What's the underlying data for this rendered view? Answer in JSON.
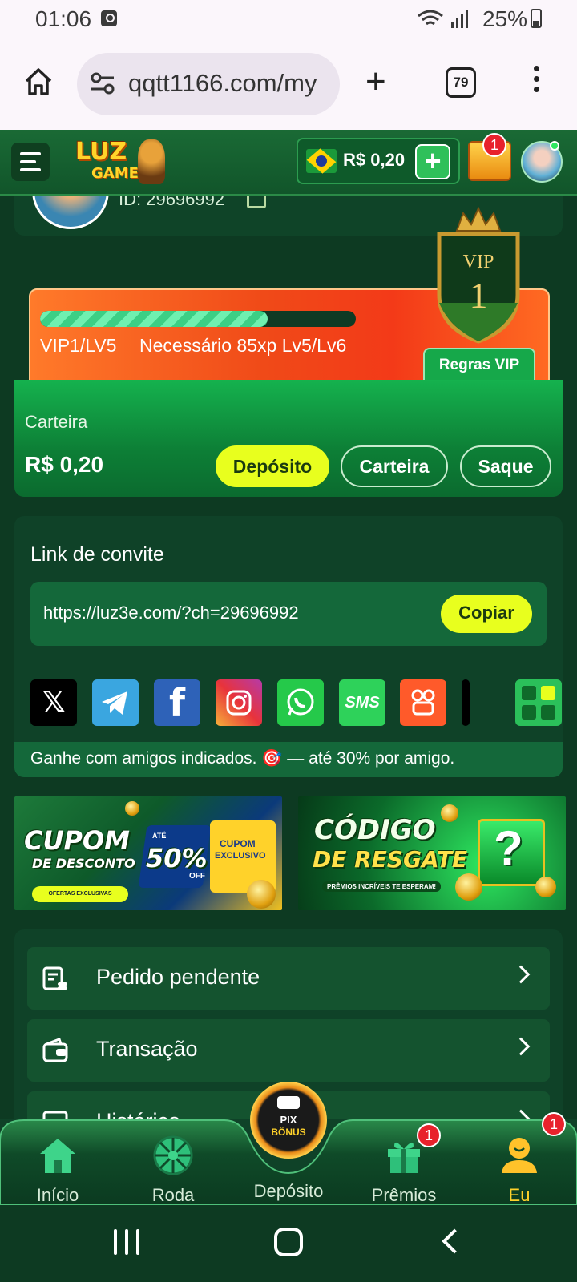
{
  "status_bar": {
    "time": "01:06",
    "battery": "25%"
  },
  "browser": {
    "url": "qqtt1166.com/my",
    "tab_count": "79"
  },
  "header": {
    "logo_line1": "LUZ",
    "logo_line2": "GAMES",
    "balance": "R$ 0,20",
    "gift_badge": "1"
  },
  "profile": {
    "id_text": "ID: 29696992"
  },
  "vip": {
    "shield_label": "VIP",
    "shield_number": "1",
    "level_text": "VIP1/LV5",
    "need_text": "Necessário 85xp Lv5/Lv6",
    "rules_button": "Regras VIP",
    "progress_fraction": 0.72
  },
  "wallet": {
    "title": "Carteira",
    "balance": "R$ 0,20",
    "deposit_button": "Depósito",
    "wallet_button": "Carteira",
    "withdraw_button": "Saque"
  },
  "invite": {
    "title": "Link de convite",
    "link": "https://luz3e.com/?ch=29696992",
    "copy_button": "Copiar",
    "footer": "Ganhe com amigos indicados. 🎯 — até 30% por amigo.",
    "social": [
      "x-icon",
      "telegram-icon",
      "facebook-icon",
      "instagram-icon",
      "whatsapp-icon",
      "sms-icon",
      "kwai-icon",
      "more-icon",
      "apps-icon"
    ],
    "sms_label": "SMS",
    "facebook_glyph": "f",
    "x_glyph": "𝕏"
  },
  "banners": {
    "cupom": {
      "line1": "CUPOM",
      "line2": "DE DESCONTO",
      "percent_prefix": "ATÉ",
      "percent": "50%",
      "off": "OFF",
      "right1": "CUPOM",
      "right2": "EXCLUSIVO",
      "sub": "OFERTAS EXCLUSIVAS"
    },
    "codigo": {
      "line1": "CÓDIGO",
      "line2": "DE RESGATE",
      "sub": "PRÊMIOS INCRÍVEIS TE ESPERAM!",
      "mark": "?"
    }
  },
  "menu": [
    {
      "label": "Pedido pendente"
    },
    {
      "label": "Transação"
    },
    {
      "label": "Histórico"
    }
  ],
  "bottom_nav": {
    "items": [
      {
        "label": "Início"
      },
      {
        "label": "Roda"
      },
      {
        "label": "Depósito"
      },
      {
        "label": "Prêmios",
        "badge": "1"
      },
      {
        "label": "Eu",
        "badge": "1"
      }
    ],
    "pix_line1": "PIX",
    "pix_line2": "BÔNUS"
  },
  "colors": {
    "accent_yellow": "#e8ff1e",
    "brand_green": "#15b24e",
    "badge_red": "#e8222c"
  }
}
